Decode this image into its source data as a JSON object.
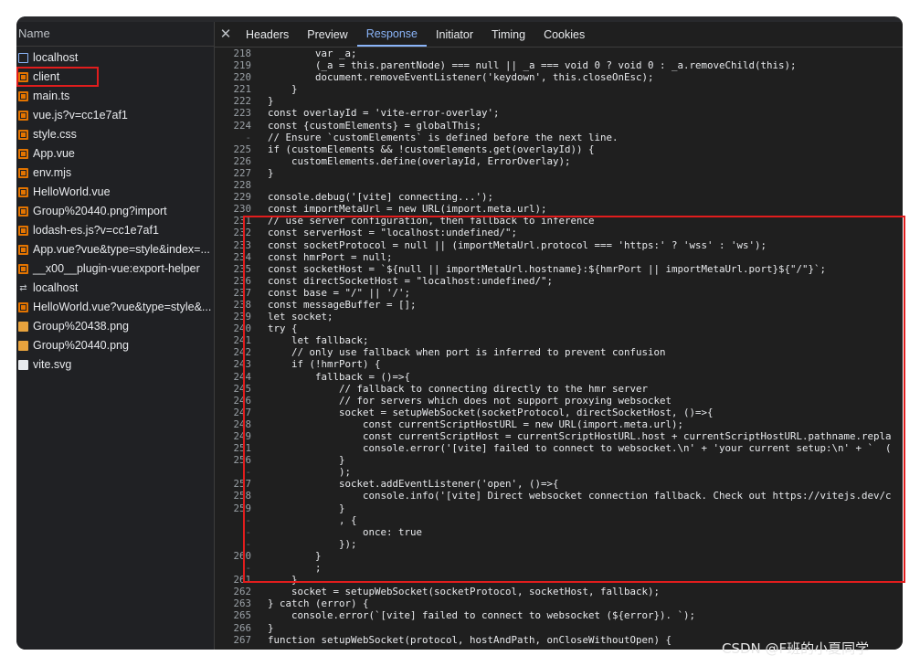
{
  "sidebar": {
    "header": "Name",
    "items": [
      {
        "label": "localhost",
        "icon": "document-icon"
      },
      {
        "label": "client",
        "icon": "script-icon"
      },
      {
        "label": "main.ts",
        "icon": "script-icon"
      },
      {
        "label": "vue.js?v=cc1e7af1",
        "icon": "script-icon"
      },
      {
        "label": "style.css",
        "icon": "script-icon"
      },
      {
        "label": "App.vue",
        "icon": "script-icon"
      },
      {
        "label": "env.mjs",
        "icon": "script-icon"
      },
      {
        "label": "HelloWorld.vue",
        "icon": "script-icon"
      },
      {
        "label": "Group%20440.png?import",
        "icon": "script-icon"
      },
      {
        "label": "lodash-es.js?v=cc1e7af1",
        "icon": "script-icon"
      },
      {
        "label": "App.vue?vue&type=style&index=...",
        "icon": "script-icon"
      },
      {
        "label": "__x00__plugin-vue:export-helper",
        "icon": "script-icon"
      },
      {
        "label": "localhost",
        "icon": "websocket-icon"
      },
      {
        "label": "HelloWorld.vue?vue&type=style&...",
        "icon": "script-icon"
      },
      {
        "label": "Group%20438.png",
        "icon": "image-icon"
      },
      {
        "label": "Group%20440.png",
        "icon": "image-icon"
      },
      {
        "label": "vite.svg",
        "icon": "svg-icon"
      }
    ]
  },
  "tabs": {
    "close": "✕",
    "items": [
      "Headers",
      "Preview",
      "Response",
      "Initiator",
      "Timing",
      "Cookies"
    ],
    "active": "Response"
  },
  "code": [
    {
      "ln": "218",
      "text": "        var _a;"
    },
    {
      "ln": "219",
      "text": "        (_a = this.parentNode) === null || _a === void 0 ? void 0 : _a.removeChild(this);"
    },
    {
      "ln": "220",
      "text": "        document.removeEventListener('keydown', this.closeOnEsc);"
    },
    {
      "ln": "221",
      "text": "    }"
    },
    {
      "ln": "222",
      "text": "}"
    },
    {
      "ln": "223",
      "text": "const overlayId = 'vite-error-overlay';"
    },
    {
      "ln": "224",
      "text": "const {customElements} = globalThis;"
    },
    {
      "ln": "-",
      "text": "// Ensure `customElements` is defined before the next line."
    },
    {
      "ln": "225",
      "text": "if (customElements && !customElements.get(overlayId)) {"
    },
    {
      "ln": "226",
      "text": "    customElements.define(overlayId, ErrorOverlay);"
    },
    {
      "ln": "227",
      "text": "}"
    },
    {
      "ln": "228",
      "text": ""
    },
    {
      "ln": "229",
      "text": "console.debug('[vite] connecting...');"
    },
    {
      "ln": "230",
      "text": "const importMetaUrl = new URL(import.meta.url);"
    },
    {
      "ln": "231",
      "text": "// use server configuration, then fallback to inference"
    },
    {
      "ln": "232",
      "text": "const serverHost = \"localhost:undefined/\";"
    },
    {
      "ln": "233",
      "text": "const socketProtocol = null || (importMetaUrl.protocol === 'https:' ? 'wss' : 'ws');"
    },
    {
      "ln": "234",
      "text": "const hmrPort = null;"
    },
    {
      "ln": "235",
      "text": "const socketHost = `${null || importMetaUrl.hostname}:${hmrPort || importMetaUrl.port}${\"/\"}`;"
    },
    {
      "ln": "236",
      "text": "const directSocketHost = \"localhost:undefined/\";"
    },
    {
      "ln": "237",
      "text": "const base = \"/\" || '/';"
    },
    {
      "ln": "238",
      "text": "const messageBuffer = [];"
    },
    {
      "ln": "239",
      "text": "let socket;"
    },
    {
      "ln": "240",
      "text": "try {"
    },
    {
      "ln": "241",
      "text": "    let fallback;"
    },
    {
      "ln": "242",
      "text": "    // only use fallback when port is inferred to prevent confusion"
    },
    {
      "ln": "243",
      "text": "    if (!hmrPort) {"
    },
    {
      "ln": "244",
      "text": "        fallback = ()=>{"
    },
    {
      "ln": "245",
      "text": "            // fallback to connecting directly to the hmr server"
    },
    {
      "ln": "246",
      "text": "            // for servers which does not support proxying websocket"
    },
    {
      "ln": "247",
      "text": "            socket = setupWebSocket(socketProtocol, directSocketHost, ()=>{"
    },
    {
      "ln": "248",
      "text": "                const currentScriptHostURL = new URL(import.meta.url);"
    },
    {
      "ln": "249",
      "text": "                const currentScriptHost = currentScriptHostURL.host + currentScriptHostURL.pathname.repla"
    },
    {
      "ln": "251",
      "text": "                console.error('[vite] failed to connect to websocket.\\n' + 'your current setup:\\n' + `  ("
    },
    {
      "ln": "256",
      "text": "            }"
    },
    {
      "ln": "-",
      "text": "            );"
    },
    {
      "ln": "257",
      "text": "            socket.addEventListener('open', ()=>{"
    },
    {
      "ln": "258",
      "text": "                console.info('[vite] Direct websocket connection fallback. Check out https://vitejs.dev/c"
    },
    {
      "ln": "259",
      "text": "            }"
    },
    {
      "ln": "-",
      "text": "            , {"
    },
    {
      "ln": "-",
      "text": "                once: true"
    },
    {
      "ln": "-",
      "text": "            });"
    },
    {
      "ln": "260",
      "text": "        }"
    },
    {
      "ln": "-",
      "text": "        ;"
    },
    {
      "ln": "261",
      "text": "    }"
    },
    {
      "ln": "262",
      "text": "    socket = setupWebSocket(socketProtocol, socketHost, fallback);"
    },
    {
      "ln": "263",
      "text": "} catch (error) {"
    },
    {
      "ln": "265",
      "text": "    console.error(`[vite] failed to connect to websocket (${error}). `);"
    },
    {
      "ln": "266",
      "text": "}"
    },
    {
      "ln": "267",
      "text": "function setupWebSocket(protocol, hostAndPath, onCloseWithoutOpen) {"
    }
  ],
  "watermark": "CSDN @F班的小夏同学",
  "colors": {
    "highlight_border": "#e11d1d",
    "active_tab": "#8ab4f8",
    "keyword": "#c58af9",
    "string": "#f29766"
  }
}
